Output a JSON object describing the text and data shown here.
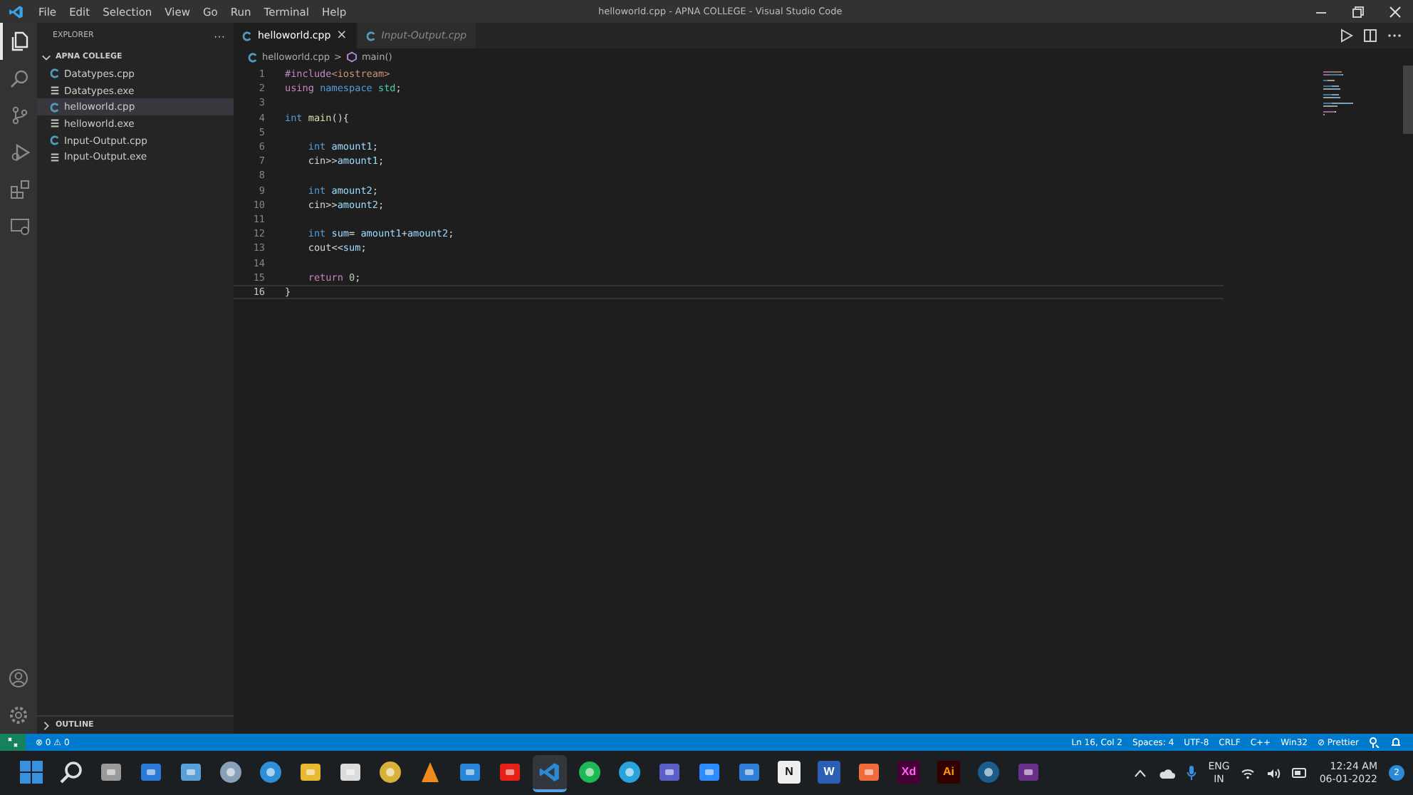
{
  "window": {
    "title": "helloworld.cpp - APNA COLLEGE - Visual Studio Code"
  },
  "menu": [
    "File",
    "Edit",
    "Selection",
    "View",
    "Go",
    "Run",
    "Terminal",
    "Help"
  ],
  "activity_bar": [
    {
      "kind": "files",
      "selected": true
    },
    {
      "kind": "search",
      "selected": false
    },
    {
      "kind": "scm",
      "selected": false
    },
    {
      "kind": "run",
      "selected": false
    },
    {
      "kind": "extensions",
      "selected": false
    },
    {
      "kind": "remote",
      "selected": false
    }
  ],
  "sidebar": {
    "title": "EXPLORER",
    "more": "···",
    "folder": {
      "name": "APNA COLLEGE",
      "expanded": true,
      "files": [
        {
          "name": "Datatypes.cpp",
          "kind": "cpp",
          "selected": false
        },
        {
          "name": "Datatypes.exe",
          "kind": "exe",
          "selected": false
        },
        {
          "name": "helloworld.cpp",
          "kind": "cpp",
          "selected": true
        },
        {
          "name": "helloworld.exe",
          "kind": "exe",
          "selected": false
        },
        {
          "name": "Input-Output.cpp",
          "kind": "cpp",
          "selected": false
        },
        {
          "name": "Input-Output.exe",
          "kind": "exe",
          "selected": false
        }
      ]
    },
    "outline": {
      "label": "OUTLINE",
      "expanded": false
    }
  },
  "tabs": [
    {
      "label": "helloworld.cpp",
      "selected": true,
      "close": "×"
    },
    {
      "label": "Input-Output.cpp",
      "selected": false
    }
  ],
  "breadcrumb": {
    "file": "helloworld.cpp",
    "separator": ">",
    "symbol": "main()"
  },
  "code": [
    {
      "number": "1",
      "current": false,
      "tokens": [
        {
          "text": "#include",
          "kind": "directive"
        },
        {
          "text": "<iostream>",
          "kind": "string"
        }
      ]
    },
    {
      "number": "2",
      "current": false,
      "tokens": [
        {
          "text": "using ",
          "kind": "control"
        },
        {
          "text": "namespace ",
          "kind": "keyword"
        },
        {
          "text": "std",
          "kind": "type"
        },
        {
          "text": ";",
          "kind": "plain"
        }
      ]
    },
    {
      "number": "3",
      "current": false
    },
    {
      "number": "4",
      "current": false,
      "tokens": [
        {
          "text": "int ",
          "kind": "keyword"
        },
        {
          "text": "main",
          "kind": "function"
        },
        {
          "text": "(){",
          "kind": "plain"
        }
      ]
    },
    {
      "number": "5",
      "current": false
    },
    {
      "number": "6",
      "current": false,
      "tokens": [
        {
          "text": "    int ",
          "kind": "keyword"
        },
        {
          "text": "amount1",
          "kind": "variable"
        },
        {
          "text": ";",
          "kind": "plain"
        }
      ]
    },
    {
      "number": "7",
      "current": false,
      "tokens": [
        {
          "text": "    cin>>",
          "kind": "plain"
        },
        {
          "text": "amount1",
          "kind": "variable"
        },
        {
          "text": ";",
          "kind": "plain"
        }
      ]
    },
    {
      "number": "8",
      "current": false
    },
    {
      "number": "9",
      "current": false,
      "tokens": [
        {
          "text": "    int ",
          "kind": "keyword"
        },
        {
          "text": "amount2",
          "kind": "variable"
        },
        {
          "text": ";",
          "kind": "plain"
        }
      ]
    },
    {
      "number": "10",
      "current": false,
      "tokens": [
        {
          "text": "    cin>>",
          "kind": "plain"
        },
        {
          "text": "amount2",
          "kind": "variable"
        },
        {
          "text": ";",
          "kind": "plain"
        }
      ]
    },
    {
      "number": "11",
      "current": false
    },
    {
      "number": "12",
      "current": false,
      "tokens": [
        {
          "text": "    int ",
          "kind": "keyword"
        },
        {
          "text": "sum",
          "kind": "variable"
        },
        {
          "text": "= ",
          "kind": "plain"
        },
        {
          "text": "amount1",
          "kind": "variable"
        },
        {
          "text": "+",
          "kind": "plain"
        },
        {
          "text": "amount2",
          "kind": "variable"
        },
        {
          "text": ";",
          "kind": "plain"
        }
      ]
    },
    {
      "number": "13",
      "current": false,
      "tokens": [
        {
          "text": "    cout<<",
          "kind": "plain"
        },
        {
          "text": "sum",
          "kind": "variable"
        },
        {
          "text": ";",
          "kind": "plain"
        }
      ]
    },
    {
      "number": "14",
      "current": false
    },
    {
      "number": "15",
      "current": false,
      "tokens": [
        {
          "text": "    return ",
          "kind": "control"
        },
        {
          "text": "0",
          "kind": "number"
        },
        {
          "text": ";",
          "kind": "plain"
        }
      ]
    },
    {
      "number": "16",
      "current": true,
      "tokens": [
        {
          "text": "}",
          "kind": "plain"
        }
      ]
    }
  ],
  "status_bar": {
    "left": [
      {
        "text": "⊗ 0 ⚠ 0"
      }
    ],
    "right": [
      {
        "text": "Ln 16, Col 2"
      },
      {
        "text": "Spaces: 4"
      },
      {
        "text": "UTF-8"
      },
      {
        "text": "CRLF"
      },
      {
        "text": "C++"
      },
      {
        "text": "Win32"
      },
      {
        "text": "⊘ Prettier"
      }
    ]
  },
  "taskbar": {
    "apps": [
      {
        "kind": "windows"
      },
      {
        "kind": "search"
      },
      {
        "kind": "taskview"
      },
      {
        "kind": "widgets"
      },
      {
        "kind": "photos"
      },
      {
        "kind": "settings"
      },
      {
        "kind": "edge"
      },
      {
        "kind": "folder"
      },
      {
        "kind": "store"
      },
      {
        "kind": "chrome"
      },
      {
        "kind": "vlc"
      },
      {
        "kind": "mail"
      },
      {
        "kind": "youtube"
      },
      {
        "kind": "vscode",
        "selected": true
      },
      {
        "kind": "spotify"
      },
      {
        "kind": "telegram"
      },
      {
        "kind": "teams"
      },
      {
        "kind": "zoom"
      },
      {
        "kind": "todo"
      },
      {
        "kind": "notion",
        "label": "N"
      },
      {
        "kind": "word",
        "label": "W"
      },
      {
        "kind": "figma"
      },
      {
        "kind": "xd",
        "label": "Xd"
      },
      {
        "kind": "illustrator",
        "label": "Ai"
      },
      {
        "kind": "steam"
      },
      {
        "kind": "tv"
      }
    ],
    "language": [
      "ENG",
      "IN"
    ],
    "time": "12:24 AM",
    "date": "06-01-2022",
    "notifications": "2"
  }
}
